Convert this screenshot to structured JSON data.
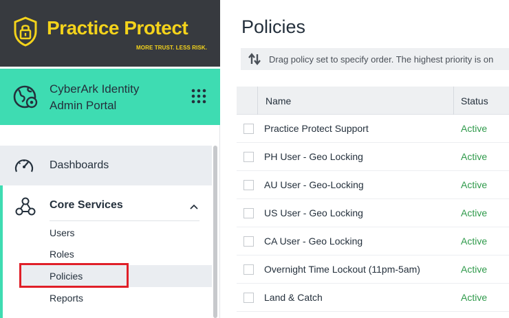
{
  "brand": {
    "name": "Practice Protect",
    "tagline": "MORE TRUST. LESS RISK.",
    "accent_color": "#f4d31b",
    "background_color": "#373a3f"
  },
  "portal": {
    "title": "CyberArk Identity\nAdmin Portal",
    "accent_color": "#3edcb2",
    "icon": "globe-gear-icon",
    "apps_icon": "app-grid-icon"
  },
  "nav": {
    "dashboards": {
      "label": "Dashboards",
      "icon": "gauge-icon"
    },
    "core_services": {
      "label": "Core Services",
      "icon": "network-nodes-icon",
      "expanded": true,
      "items": [
        {
          "label": "Users"
        },
        {
          "label": "Roles"
        },
        {
          "label": "Policies",
          "selected": true
        },
        {
          "label": "Reports"
        }
      ]
    }
  },
  "main": {
    "title": "Policies",
    "info_text": "Drag policy set to specify order. The highest priority is on",
    "info_icon": "sort-arrows-icon"
  },
  "table": {
    "columns": [
      "Name",
      "Status"
    ],
    "rows": [
      {
        "name": "Practice Protect Support",
        "status": "Active"
      },
      {
        "name": "PH User - Geo Locking",
        "status": "Active"
      },
      {
        "name": "AU User - Geo-Locking",
        "status": "Active"
      },
      {
        "name": "US User - Geo Locking",
        "status": "Active"
      },
      {
        "name": "CA User - Geo Locking",
        "status": "Active"
      },
      {
        "name": "Overnight Time Lockout (11pm-5am)",
        "status": "Active"
      },
      {
        "name": "Land & Catch",
        "status": "Active"
      }
    ],
    "status_color": "#2f9a4b"
  },
  "annotation": {
    "color": "#e01f28",
    "target": "Policies"
  }
}
